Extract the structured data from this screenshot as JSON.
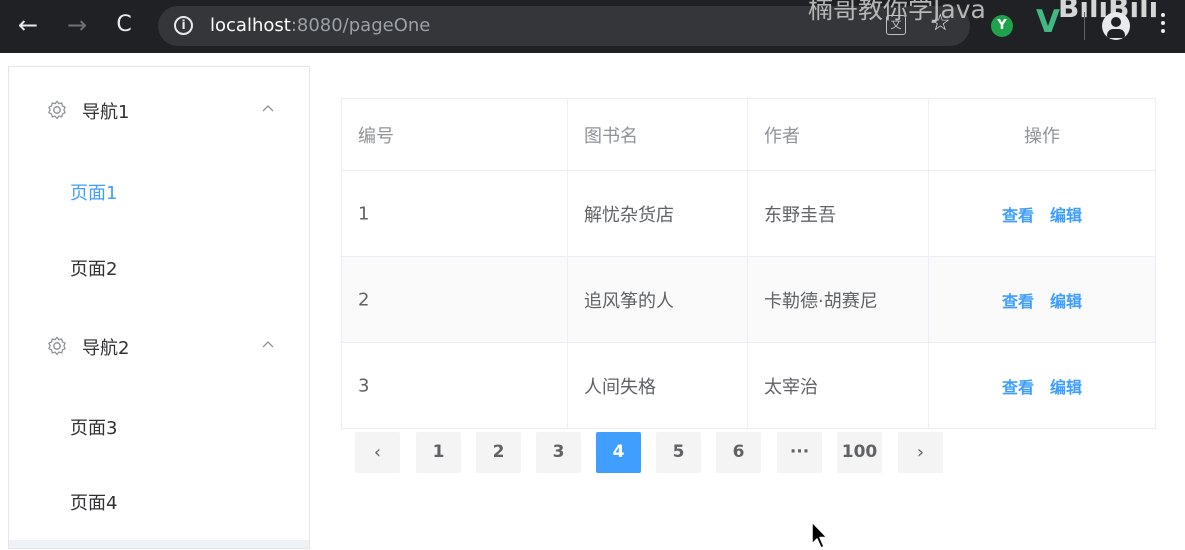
{
  "browser": {
    "back_icon": "arrow-left-icon",
    "forward_icon": "arrow-right-icon",
    "reload_icon": "reload-icon",
    "url_host": "localhost",
    "url_rest": ":8080/pageOne",
    "translate_glyph": "文",
    "star_glyph": "☆",
    "ext_y_label": "Y",
    "ext_v_label": "V",
    "watermark_text": "楠哥教你学Java",
    "watermark_logo": "BiliBili"
  },
  "sidebar": {
    "groups": [
      {
        "label": "导航1",
        "items": [
          {
            "label": "页面1",
            "active": true
          },
          {
            "label": "页面2",
            "active": false
          }
        ]
      },
      {
        "label": "导航2",
        "items": [
          {
            "label": "页面3",
            "active": false
          },
          {
            "label": "页面4",
            "active": false
          }
        ]
      }
    ]
  },
  "table": {
    "headers": [
      "编号",
      "图书名",
      "作者",
      "操作"
    ],
    "rows": [
      {
        "id": "1",
        "name": "解忧杂货店",
        "author": "东野圭吾"
      },
      {
        "id": "2",
        "name": "追风筝的人",
        "author": "卡勒德·胡赛尼"
      },
      {
        "id": "3",
        "name": "人间失格",
        "author": "太宰治"
      }
    ],
    "actions": {
      "view": "查看",
      "edit": "编辑"
    }
  },
  "pagination": {
    "prev": "‹",
    "next": "›",
    "pages": [
      "1",
      "2",
      "3",
      "4",
      "5",
      "6",
      "···",
      "100"
    ],
    "current": "4"
  },
  "colors": {
    "primary": "#409eff",
    "chrome_bg": "#202124",
    "text": "#606266",
    "header_text": "#909399"
  }
}
